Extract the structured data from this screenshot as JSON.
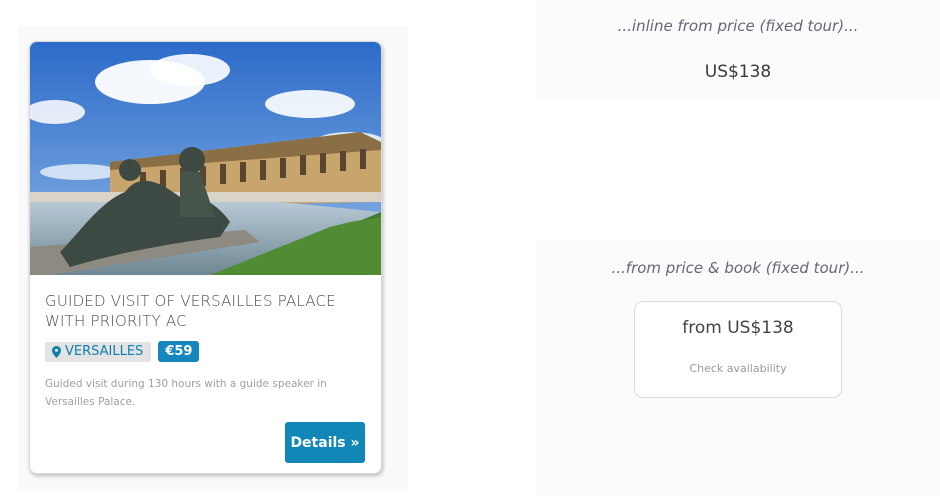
{
  "card": {
    "image_alt": "Versailles Palace",
    "title": "GUIDED VISIT OF VERSAILLES PALACE WITH PRIORITY AC",
    "location_badge": "VERSAILLES",
    "price_badge": "€59",
    "description": "Guided visit during 130 hours with a guide speaker in Versailles Palace.",
    "details_button": "Details »"
  },
  "inline_section": {
    "caption": "...inline from price (fixed tour)...",
    "price": "US$138"
  },
  "book_section": {
    "caption": "...from price & book (fixed tour)...",
    "price": "from US$138",
    "link": "Check availability"
  },
  "colors": {
    "accent": "#1187b8",
    "location_badge_bg": "#e3e3e3",
    "price_badge_bg": "#1686bf"
  }
}
